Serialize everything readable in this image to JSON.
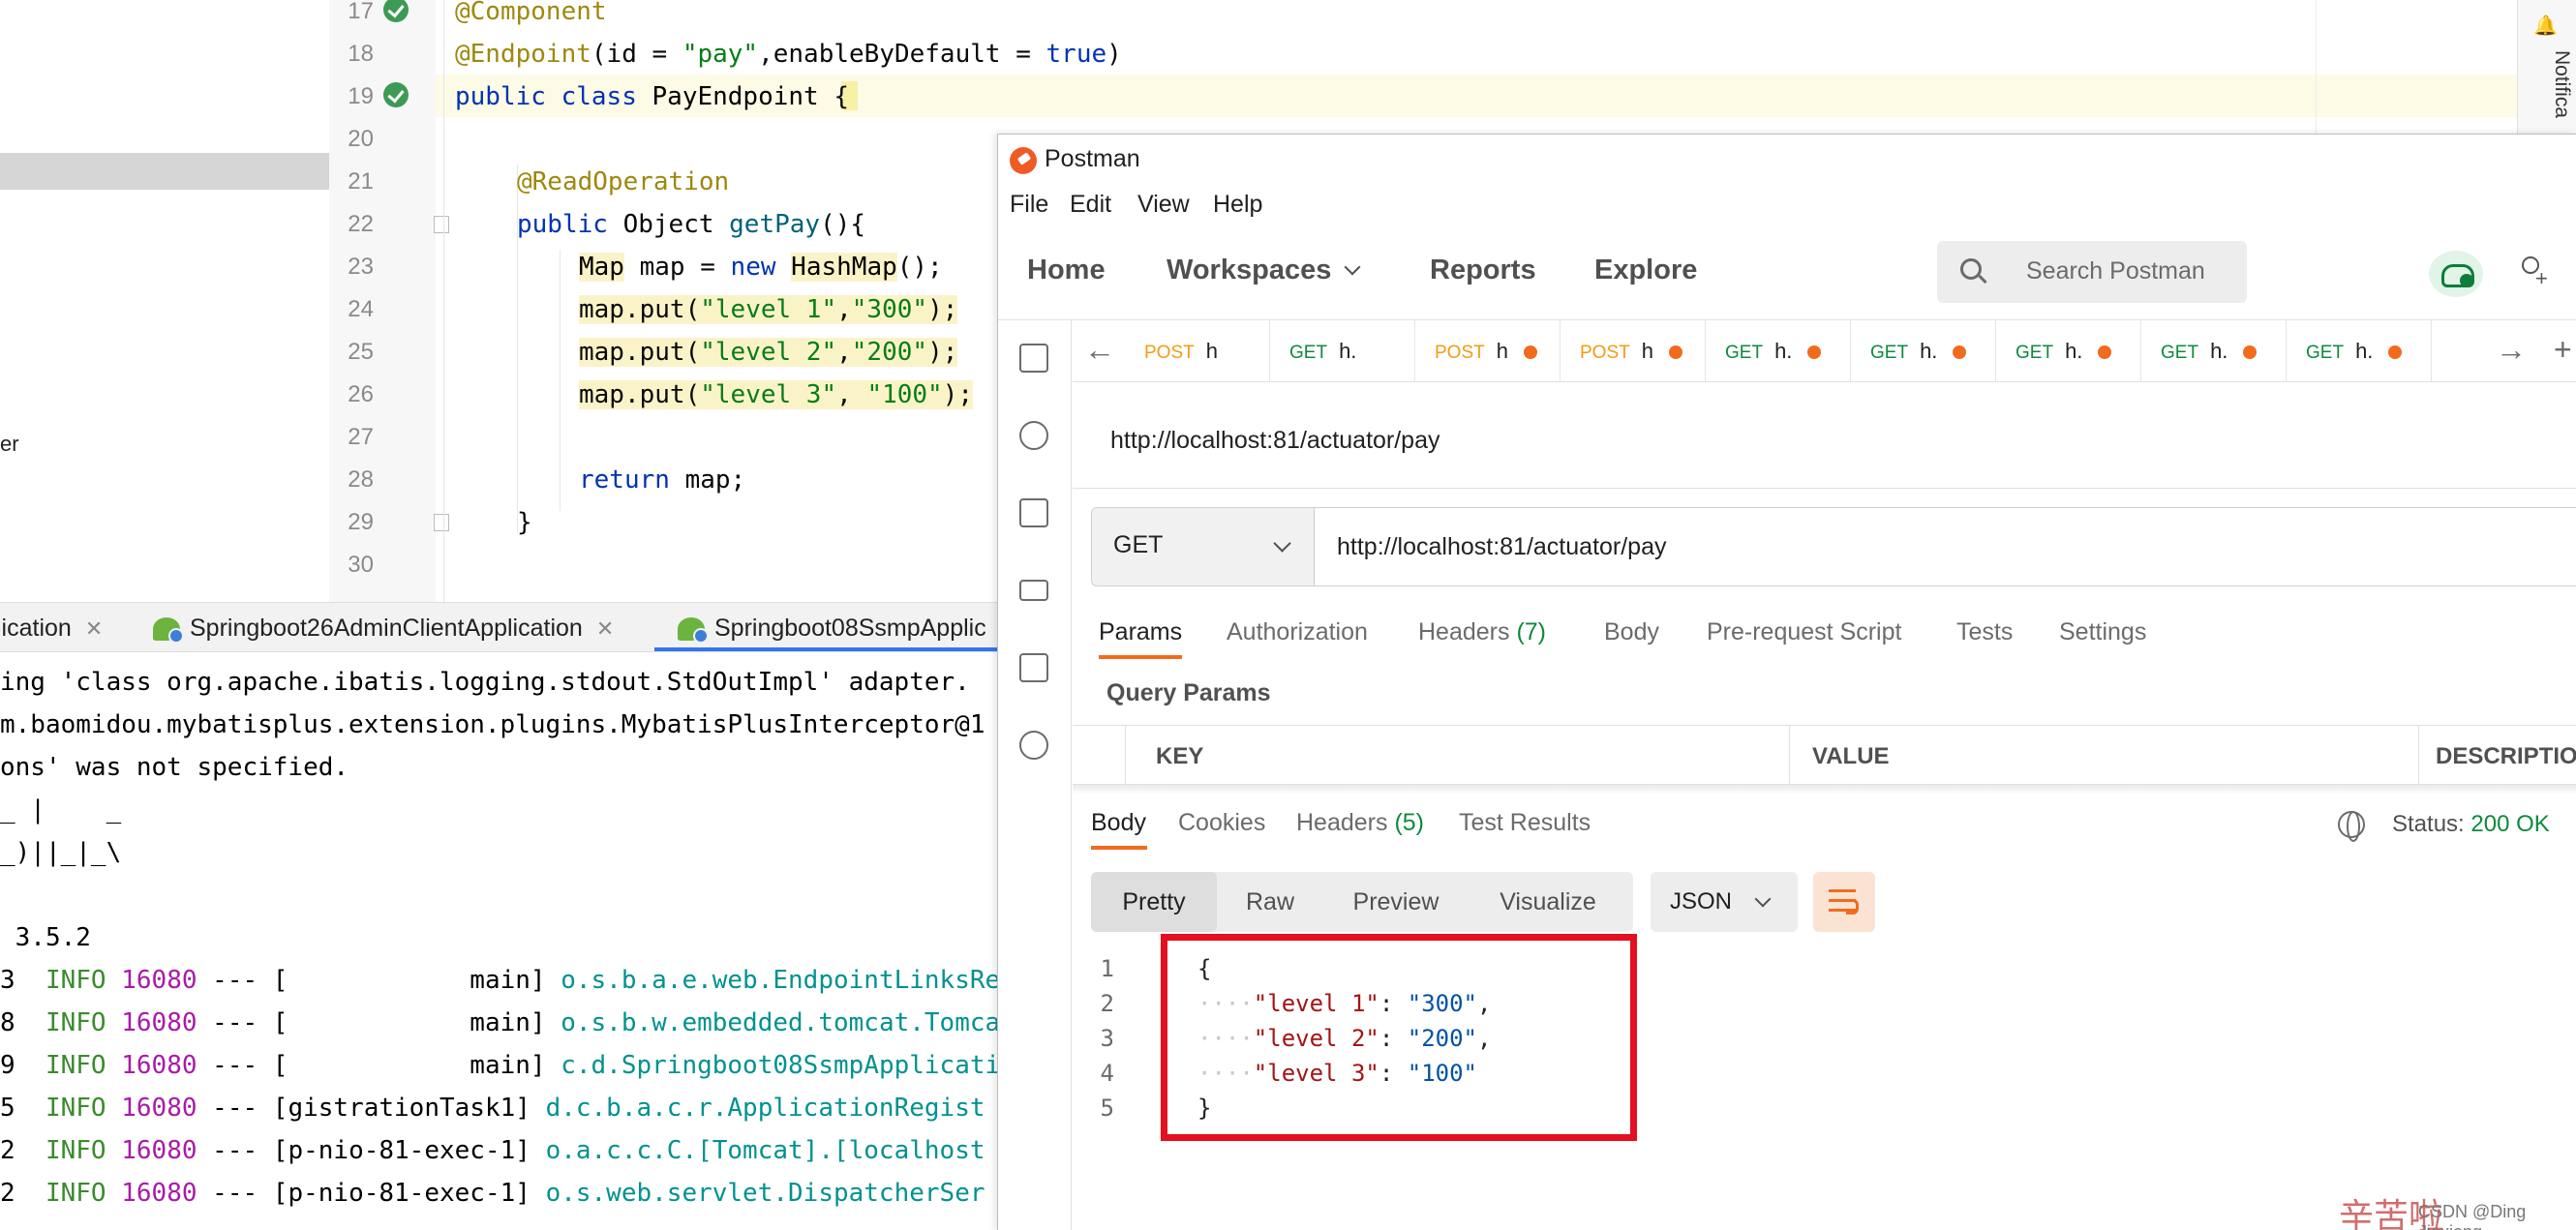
{
  "ide": {
    "project_fragment": "er",
    "line_numbers": [
      "17",
      "18",
      "19",
      "20",
      "21",
      "22",
      "23",
      "24",
      "25",
      "26",
      "27",
      "28",
      "29",
      "30"
    ],
    "code": {
      "l17_ann": "@Component",
      "l18_ann": "@Endpoint",
      "l18_a": "(id = ",
      "l18_str": "\"pay\"",
      "l18_b": ",enableByDefault = ",
      "l18_true": "true",
      "l18_c": ")",
      "l19_kw1": "public",
      "l19_kw2": "class",
      "l19_cls": "PayEndpoint",
      "l19_brace": "{",
      "l21_ann": "@ReadOperation",
      "l22_kw": "public",
      "l22_type": "Object",
      "l22_meth": "getPay",
      "l22_rest": "(){",
      "l23_map": "Map",
      "l23_a": " map = ",
      "l23_new": "new",
      "l23_hash": "HashMap",
      "l23_b": "();",
      "l24_a": "map.put(",
      "l24_k": "\"level 1\"",
      "l24_b": ",",
      "l24_v": "\"300\"",
      "l24_c": ");",
      "l25_a": "map.put(",
      "l25_k": "\"level 2\"",
      "l25_b": ",",
      "l25_v": "\"200\"",
      "l25_c": ");",
      "l26_a": "map.put(",
      "l26_k": "\"level 3\"",
      "l26_b": ", ",
      "l26_v": "\"100\"",
      "l26_c": ");",
      "l28_kw": "return",
      "l28_rest": " map;",
      "l29": "}"
    },
    "notifications_label": "Notifica",
    "run_tabs": [
      {
        "label": "lication"
      },
      {
        "label": "Springboot26AdminClientApplication"
      },
      {
        "label": "Springboot08SsmpApplic"
      }
    ],
    "console": {
      "l1": "ing 'class org.apache.ibatis.logging.stdout.StdOutImpl' adapter.",
      "l2": "m.baomidou.mybatisplus.extension.plugins.MybatisPlusInterceptor@1",
      "l3": "ons' was not specified.",
      "l4": "_ |    _",
      "l5": "_)||_|_\\",
      "l6": "",
      "l7": " 3.5.2",
      "rows": [
        {
          "prefix": "3",
          "level": "INFO",
          "pid": "16080",
          "sep": " --- [",
          "thread": "            main]",
          "logger": "o.s.b.a.e.web.EndpointLinksRe"
        },
        {
          "prefix": "8",
          "level": "INFO",
          "pid": "16080",
          "sep": " --- [",
          "thread": "            main]",
          "logger": "o.s.b.w.embedded.tomcat.Tomca"
        },
        {
          "prefix": "9",
          "level": "INFO",
          "pid": "16080",
          "sep": " --- [",
          "thread": "            main]",
          "logger": "c.d.Springboot08SsmpApplicati"
        },
        {
          "prefix": "5",
          "level": "INFO",
          "pid": "16080",
          "sep": " --- [",
          "thread": "gistrationTask1]",
          "logger": "d.c.b.a.c.r.ApplicationRegist"
        },
        {
          "prefix": "2",
          "level": "INFO",
          "pid": "16080",
          "sep": " --- [",
          "thread": "p-nio-81-exec-1]",
          "logger": "o.a.c.c.C.[Tomcat].[localhost"
        },
        {
          "prefix": "2",
          "level": "INFO",
          "pid": "16080",
          "sep": " --- [",
          "thread": "p-nio-81-exec-1]",
          "logger": "o.s.web.servlet.DispatcherSer"
        }
      ]
    }
  },
  "postman": {
    "title": "Postman",
    "menu": [
      "File",
      "Edit",
      "View",
      "Help"
    ],
    "nav": {
      "home": "Home",
      "workspaces": "Workspaces",
      "reports": "Reports",
      "explore": "Explore"
    },
    "search_placeholder": "Search Postman",
    "request_tabs": [
      {
        "method": "POST",
        "name": "h",
        "dot": false
      },
      {
        "method": "GET",
        "name": "h.",
        "dot": false
      },
      {
        "method": "POST",
        "name": "h",
        "dot": true
      },
      {
        "method": "POST",
        "name": "h",
        "dot": true
      },
      {
        "method": "GET",
        "name": "h.",
        "dot": true
      },
      {
        "method": "GET",
        "name": "h.",
        "dot": true
      },
      {
        "method": "GET",
        "name": "h.",
        "dot": true
      },
      {
        "method": "GET",
        "name": "h.",
        "dot": true
      },
      {
        "method": "GET",
        "name": "h.",
        "dot": true
      }
    ],
    "request_name": "http://localhost:81/actuator/pay",
    "method": "GET",
    "url": "http://localhost:81/actuator/pay",
    "request_tabs_section": {
      "params": "Params",
      "authorization": "Authorization",
      "headers": "Headers",
      "headers_count": "(7)",
      "body": "Body",
      "prerequest": "Pre-request Script",
      "tests": "Tests",
      "settings": "Settings"
    },
    "query_params_label": "Query Params",
    "table_headers": {
      "key": "KEY",
      "value": "VALUE",
      "description": "DESCRIPTIO"
    },
    "response_tabs": {
      "body": "Body",
      "cookies": "Cookies",
      "headers": "Headers",
      "headers_count": "(5)",
      "test_results": "Test Results"
    },
    "status_label": "Status:",
    "status_value": "200 OK",
    "view_modes": [
      "Pretty",
      "Raw",
      "Preview",
      "Visualize"
    ],
    "format": "JSON",
    "response_line_numbers": [
      "1",
      "2",
      "3",
      "4",
      "5"
    ],
    "response": {
      "open": "{",
      "k1": "\"level 1\"",
      "v1": "\"300\"",
      "k2": "\"level 2\"",
      "v2": "\"200\"",
      "k3": "\"level 3\"",
      "v3": "\"100\"",
      "close": "}"
    },
    "highlight_color": "#e40f1f",
    "accent_color": "#f26b1d"
  },
  "watermark": {
    "glyphs": "辛苦啦",
    "text": "CSDN @Ding Jiaxiong"
  }
}
